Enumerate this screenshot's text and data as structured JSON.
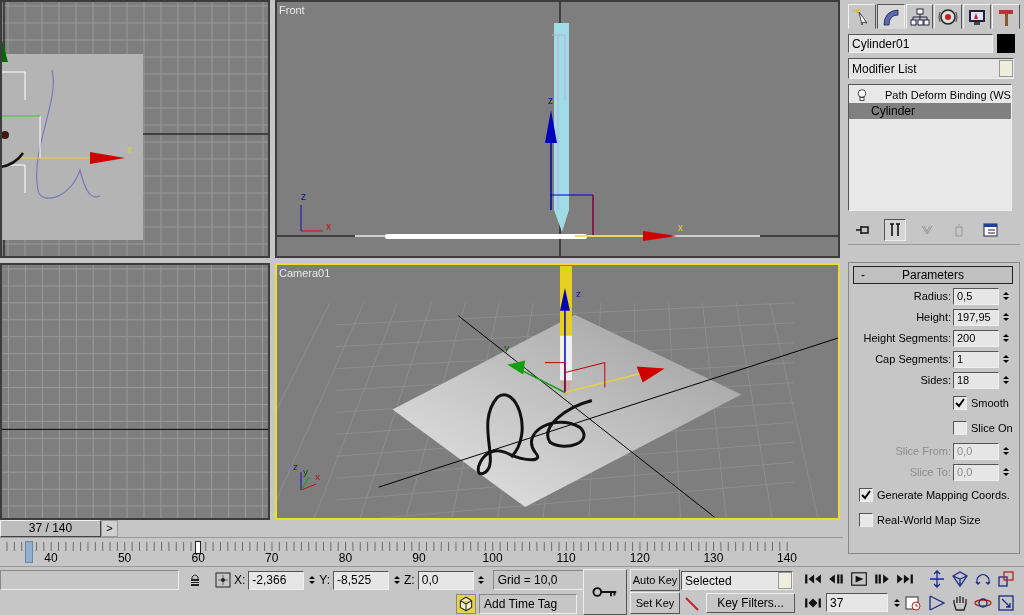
{
  "viewports": [
    {
      "kind": "top",
      "active": false,
      "axis_labels": [
        "x"
      ]
    },
    {
      "kind": "front",
      "title": "Front",
      "active": false,
      "axis_labels": [
        "z",
        "x",
        "z",
        "x"
      ]
    },
    {
      "kind": "left",
      "active": false
    },
    {
      "kind": "camera",
      "title": "Camera01",
      "active": true,
      "axis_labels": [
        "z",
        "y",
        "z",
        "y",
        "x"
      ]
    }
  ],
  "command_panel": {
    "tabs": [
      {
        "selected": false
      },
      {
        "selected": true
      },
      {
        "selected": false
      },
      {
        "selected": false
      },
      {
        "selected": false
      },
      {
        "selected": false
      }
    ],
    "object_name": "Cylinder01",
    "modifier_list": "Modifier List",
    "stack": [
      {
        "label": "Path Deform Binding (WS",
        "kind": "modifier",
        "selected": false
      },
      {
        "label": "Cylinder",
        "kind": "base",
        "selected": true
      }
    ],
    "stack_tools": [
      {
        "selected": false,
        "disabled": false
      },
      {
        "selected": true,
        "disabled": false
      },
      {
        "selected": false,
        "disabled": true
      },
      {
        "selected": false,
        "disabled": true
      },
      {
        "selected": false,
        "disabled": false
      }
    ],
    "rollout": {
      "toggle": "-",
      "title": "Parameters",
      "controls": [
        {
          "kind": "spinner",
          "label": "Radius:",
          "value": "0,5",
          "disabled": false
        },
        {
          "kind": "spinner",
          "label": "Height:",
          "value": "197,95",
          "disabled": false
        },
        {
          "kind": "spinner",
          "label": "Height Segments:",
          "value": "200",
          "disabled": false
        },
        {
          "kind": "spinner",
          "label": "Cap Segments:",
          "value": "1",
          "disabled": false
        },
        {
          "kind": "spinner",
          "label": "Sides:",
          "value": "18",
          "disabled": false
        },
        {
          "kind": "checkbox",
          "label": "Smooth",
          "checked": true
        },
        {
          "kind": "checkbox",
          "label": "Slice On",
          "checked": false
        },
        {
          "kind": "spinner",
          "label": "Slice From:",
          "value": "0,0",
          "disabled": true
        },
        {
          "kind": "spinner",
          "label": "Slice To:",
          "value": "0,0",
          "disabled": true
        },
        {
          "kind": "option",
          "label": "Generate Mapping Coords.",
          "checked": true
        },
        {
          "kind": "option",
          "label": "Real-World Map Size",
          "checked": false
        }
      ]
    }
  },
  "time_slider": {
    "label": "37 / 140",
    "next": ">"
  },
  "ruler": {
    "labels": [
      "40",
      "50",
      "60",
      "70",
      "80",
      "90",
      "100",
      "110",
      "120",
      "130",
      "140"
    ]
  },
  "status": {
    "coords": [
      {
        "label": "X:",
        "value": "-2,366"
      },
      {
        "label": "Y:",
        "value": "-8,525"
      },
      {
        "label": "Z:",
        "value": "0,0"
      }
    ],
    "grid": "Grid = 10,0",
    "add_time_tag": "Add Time Tag",
    "auto_key": "Auto Key",
    "set_key": "Set Key",
    "key_mode": "Selected",
    "key_filters": "Key Filters...",
    "frame": "37"
  }
}
